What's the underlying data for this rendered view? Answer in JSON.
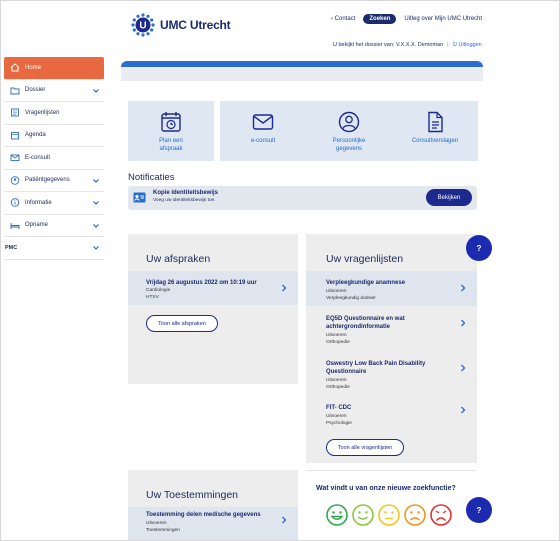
{
  "brand": {
    "name": "UMC Utrecht",
    "mark": "U"
  },
  "toplinks": {
    "contact": "Contact",
    "search": "Zoeken",
    "explain": "Uitleg over Mijn UMC Utrecht"
  },
  "userbar": {
    "text": "U bekijkt het dossier van: V.X.X.X. Demoman",
    "logout": "Uitloggen"
  },
  "sidebar": {
    "items": [
      {
        "label": "Home",
        "icon": "home-icon"
      },
      {
        "label": "Dossier",
        "icon": "folder-icon"
      },
      {
        "label": "Vragenlijsten",
        "icon": "list-icon"
      },
      {
        "label": "Agenda",
        "icon": "calendar-icon"
      },
      {
        "label": "E-consult",
        "icon": "mail-icon"
      },
      {
        "label": "Patiëntgegevens",
        "icon": "person-icon"
      },
      {
        "label": "Informatie",
        "icon": "info-icon"
      },
      {
        "label": "Opname",
        "icon": "bed-icon"
      },
      {
        "label": "PMC",
        "icon": ""
      }
    ]
  },
  "tiles": [
    {
      "label": "Plan een afspraak",
      "icon": "calendar-clock-icon"
    },
    {
      "label": "e-consult",
      "icon": "envelope-icon"
    },
    {
      "label": "Persoonlijke gegevens",
      "icon": "user-circle-icon"
    },
    {
      "label": "Consultverslagen",
      "icon": "document-icon"
    }
  ],
  "notifications": {
    "title": "Notificaties",
    "item": {
      "title": "Kopie identiteitsbewijs",
      "subtitle": "Voeg uw identiteitsbewijs toe.",
      "button": "Bekijken"
    }
  },
  "appointments": {
    "title": "Uw afspraken",
    "items": [
      {
        "title": "Vrijdag 26 augustus 2022 om 10:19 uur",
        "l1": "Cardiologie",
        "l2": "HTXV"
      }
    ],
    "button": "Toon alle afspraken"
  },
  "questionnaires": {
    "title": "Uw vragenlijsten",
    "items": [
      {
        "title": "Verpleegkundige anamnese",
        "l1": "Uitvoeren",
        "l2": "Verpleegkundig dossier"
      },
      {
        "title": "EQ5D Questionnaire en wat achtergrondinformatie",
        "l1": "Uitvoeren",
        "l2": "Orthopedie"
      },
      {
        "title": "Oswestry Low Back Pain Disability Questionnaire",
        "l1": "Uitvoeren",
        "l2": "Orthopedie"
      },
      {
        "title": "FIT- CDC",
        "l1": "Uitvoeren",
        "l2": "Psychologie"
      }
    ],
    "button": "Toon alle vragenlijsten"
  },
  "consents": {
    "title": "Uw Toestemmingen",
    "items": [
      {
        "title": "Toestemming delen medische gegevens",
        "l1": "Uitvoeren",
        "l2": "Toestemmingen"
      }
    ]
  },
  "feedback": {
    "question": "Wat vindt u van onze nieuwe zoekfunctie?",
    "faces": [
      "very-happy-face-icon",
      "happy-face-icon",
      "neutral-face-icon",
      "sad-face-icon",
      "very-sad-face-icon"
    ]
  },
  "help": {
    "label": "?"
  },
  "colors": {
    "accent": "#e8683f",
    "navy": "#1c2a6e",
    "blue": "#2a6fcf"
  }
}
